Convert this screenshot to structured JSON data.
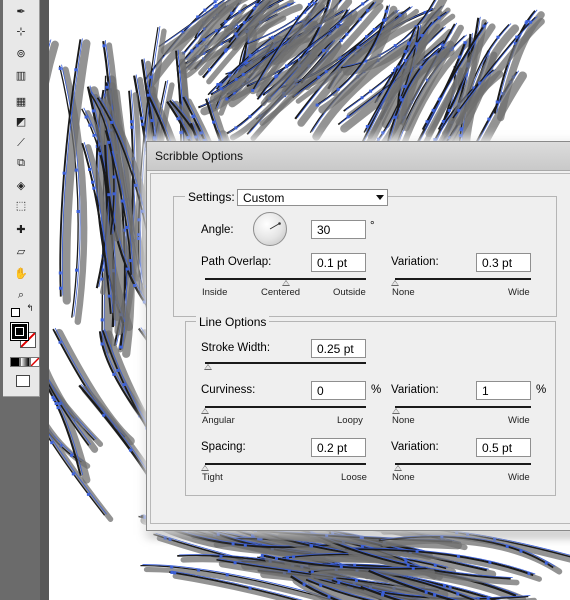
{
  "dialog": {
    "title": "Scribble Options",
    "settings": {
      "label": "Settings:",
      "value": "Custom"
    },
    "angle": {
      "label": "Angle:",
      "value": "30",
      "unit": "°"
    },
    "path_overlap": {
      "label": "Path Overlap:",
      "value": "0.1 pt",
      "slider_fraction": 0.5,
      "min_label": "Inside",
      "mid_label": "Centered",
      "max_label": "Outside"
    },
    "path_overlap_variation": {
      "label": "Variation:",
      "value": "0.3 pt",
      "slider_fraction": 0.0,
      "min_label": "None",
      "max_label": "Wide"
    },
    "line_options": {
      "legend": "Line Options",
      "stroke_width": {
        "label": "Stroke Width:",
        "value": "0.25 pt",
        "slider_fraction": 0.02
      },
      "curviness": {
        "label": "Curviness:",
        "value": "0",
        "unit": "%",
        "slider_fraction": 0.0,
        "min_label": "Angular",
        "max_label": "Loopy"
      },
      "curviness_variation": {
        "label": "Variation:",
        "value": "1",
        "unit": "%",
        "slider_fraction": 0.01,
        "min_label": "None",
        "max_label": "Wide"
      },
      "spacing": {
        "label": "Spacing:",
        "value": "0.2 pt",
        "slider_fraction": 0.0,
        "min_label": "Tight",
        "max_label": "Loose"
      },
      "spacing_variation": {
        "label": "Variation:",
        "value": "0.5 pt",
        "slider_fraction": 0.02,
        "min_label": "None",
        "max_label": "Wide"
      }
    }
  },
  "tools": [
    "pen-tool-icon",
    "direct-selection-icon",
    "scatter-symbol-icon",
    "graph-icon",
    "mesh-icon",
    "gradient-icon",
    "eyedropper-icon",
    "blend-icon",
    "live-paint-icon",
    "live-paint-selection-icon",
    "slice-icon",
    "eraser-icon",
    "hand-icon",
    "zoom-icon"
  ],
  "colors": {
    "sketch_blue": "#3a5fd8",
    "sketch_dark": "#1a1a1a",
    "sketch_gray": "#6f6f6f"
  }
}
